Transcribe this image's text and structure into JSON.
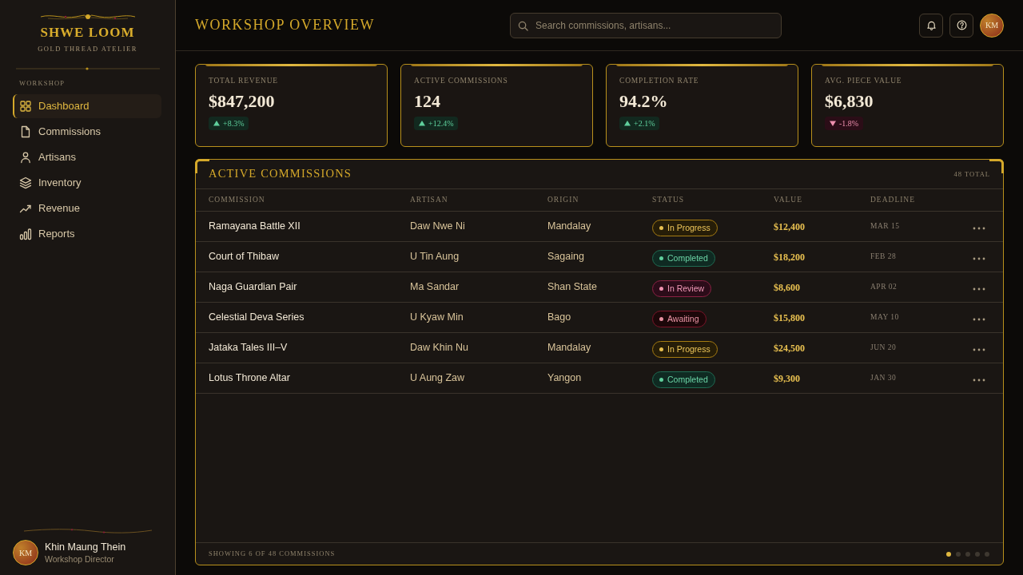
{
  "sidebar": {
    "brand": {
      "name": "SHWE LOOM",
      "tagline": "GOLD THREAD ATELIER"
    },
    "section_label": "WORKSHOP",
    "items": [
      {
        "label": "Dashboard",
        "selected": true
      },
      {
        "label": "Commissions",
        "selected": false
      },
      {
        "label": "Artisans",
        "selected": false
      },
      {
        "label": "Inventory",
        "selected": false
      },
      {
        "label": "Revenue",
        "selected": false
      },
      {
        "label": "Reports",
        "selected": false
      }
    ],
    "user": {
      "initials": "KM",
      "name": "Khin Maung Thein",
      "role": "Workshop Director"
    }
  },
  "header": {
    "title": "WORKSHOP OVERVIEW",
    "search": {
      "placeholder": "Search commissions, artisans..."
    },
    "avatar": {
      "initials": "KM"
    }
  },
  "stats": [
    {
      "label": "TOTAL REVENUE",
      "value": "$847,200",
      "change": {
        "kind": "up",
        "text": "+8.3%"
      }
    },
    {
      "label": "ACTIVE COMMISSIONS",
      "value": "124",
      "change": {
        "kind": "up",
        "text": "+12.4%"
      }
    },
    {
      "label": "COMPLETION RATE",
      "value": "94.2%",
      "change": {
        "kind": "up",
        "text": "+2.1%"
      }
    },
    {
      "label": "AVG. PIECE VALUE",
      "value": "$6,830",
      "change": {
        "kind": "down",
        "text": "-1.8%"
      }
    }
  ],
  "table": {
    "title": "ACTIVE COMMISSIONS",
    "total": "48 TOTAL",
    "columns": [
      "COMMISSION",
      "ARTISAN",
      "ORIGIN",
      "STATUS",
      "VALUE",
      "DEADLINE"
    ],
    "rows": [
      {
        "commission": "Ramayana Battle XII",
        "artisan": "Daw Nwe Ni",
        "origin": "Mandalay",
        "status": {
          "kind": "in_progress",
          "text": "In Progress"
        },
        "value": "$12,400",
        "deadline": "MAR 15"
      },
      {
        "commission": "Court of Thibaw",
        "artisan": "U Tin Aung",
        "origin": "Sagaing",
        "status": {
          "kind": "completed",
          "text": "Completed"
        },
        "value": "$18,200",
        "deadline": "FEB 28"
      },
      {
        "commission": "Naga Guardian Pair",
        "artisan": "Ma Sandar",
        "origin": "Shan State",
        "status": {
          "kind": "review",
          "text": "In Review"
        },
        "value": "$8,600",
        "deadline": "APR 02"
      },
      {
        "commission": "Celestial Deva Series",
        "artisan": "U Kyaw Min",
        "origin": "Bago",
        "status": {
          "kind": "awaiting",
          "text": "Awaiting"
        },
        "value": "$15,800",
        "deadline": "MAY 10"
      },
      {
        "commission": "Jataka Tales III–V",
        "artisan": "Daw Khin Nu",
        "origin": "Mandalay",
        "status": {
          "kind": "in_progress",
          "text": "In Progress"
        },
        "value": "$24,500",
        "deadline": "JUN 20"
      },
      {
        "commission": "Lotus Throne Altar",
        "artisan": "U Aung Zaw",
        "origin": "Yangon",
        "status": {
          "kind": "completed",
          "text": "Completed"
        },
        "value": "$9,300",
        "deadline": "JAN 30"
      }
    ],
    "footer": "SHOWING 6 OF 48 COMMISSIONS",
    "pages": [
      {
        "selected": true
      },
      {
        "selected": false
      },
      {
        "selected": false
      },
      {
        "selected": false
      },
      {
        "selected": false
      }
    ]
  }
}
